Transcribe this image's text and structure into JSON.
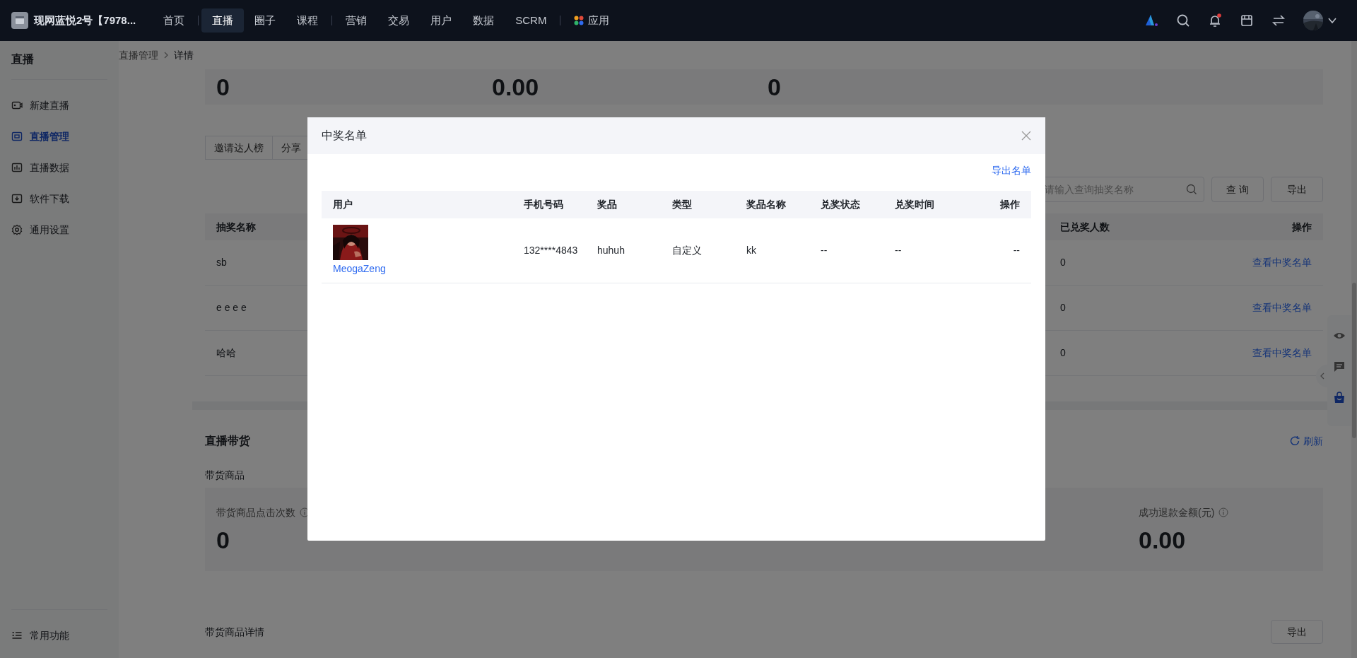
{
  "topbar": {
    "shop_name": "现网蓝悦2号【7978...",
    "nav_groups": [
      [
        {
          "label": "首页",
          "kind": "link",
          "selected": false
        }
      ],
      [
        {
          "label": "直播",
          "kind": "link",
          "selected": true
        },
        {
          "label": "圈子",
          "kind": "link",
          "selected": false
        },
        {
          "label": "课程",
          "kind": "link",
          "selected": false
        }
      ],
      [
        {
          "label": "营销",
          "kind": "link",
          "selected": false
        },
        {
          "label": "交易",
          "kind": "link",
          "selected": false
        },
        {
          "label": "用户",
          "kind": "link",
          "selected": false
        },
        {
          "label": "数据",
          "kind": "link",
          "selected": false
        },
        {
          "label": "SCRM",
          "kind": "link",
          "selected": false
        }
      ],
      [
        {
          "label": "应用",
          "kind": "apps",
          "selected": false
        }
      ]
    ],
    "unread_notifications": true
  },
  "sidebar": {
    "title": "直播",
    "items": [
      {
        "label": "新建直播",
        "selected": false
      },
      {
        "label": "直播管理",
        "selected": true
      },
      {
        "label": "直播数据",
        "selected": false
      },
      {
        "label": "软件下载",
        "selected": false
      },
      {
        "label": "通用设置",
        "selected": false
      }
    ],
    "footer": "常用功能"
  },
  "breadcrumb": [
    "直播管理",
    "详情"
  ],
  "overview_values": [
    "0",
    "0.00",
    "0"
  ],
  "lottery": {
    "tabs": [
      "邀请达人榜",
      "分享"
    ],
    "search": {
      "placeholder": "请输入查询抽奖名称"
    },
    "buttons": [
      "查 询",
      "导出"
    ],
    "columns": [
      "抽奖名称",
      "已兑奖人数",
      "操作"
    ],
    "rows": [
      {
        "name": "sb",
        "redeemed": "0",
        "action": "查看中奖名单"
      },
      {
        "name": "e e e e",
        "redeemed": "0",
        "action": "查看中奖名单"
      },
      {
        "name": "哈哈",
        "redeemed": "0",
        "action": "查看中奖名单"
      }
    ]
  },
  "sales": {
    "title": "直播带货",
    "refresh": "刷新",
    "subtitle": "带货商品",
    "stats": {
      "first": {
        "label": "带货商品点击次数",
        "value": "0"
      },
      "last": {
        "label": "成功退款金额(元)",
        "value": "0.00"
      }
    },
    "details_title": "带货商品详情",
    "export": "导出"
  },
  "modal": {
    "title": "中奖名单",
    "export_link": "导出名单",
    "columns": [
      "用户",
      "手机号码",
      "奖品",
      "类型",
      "奖品名称",
      "兑奖状态",
      "兑奖时间",
      "操作"
    ],
    "rows": [
      {
        "user": "MeogaZeng",
        "phone": "132****4843",
        "prize": "huhuh",
        "type": "自定义",
        "prize_name": "kk",
        "status": "--",
        "time": "--",
        "action": "--"
      }
    ]
  }
}
